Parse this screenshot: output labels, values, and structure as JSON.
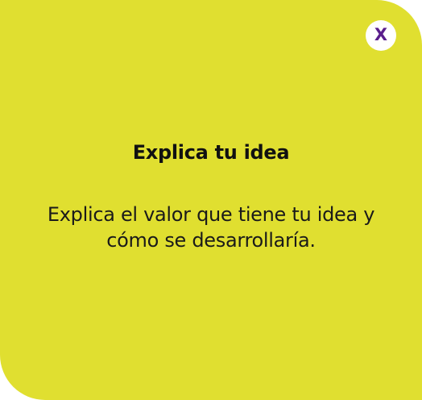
{
  "popup": {
    "close_label": "X",
    "title": "Explica tu idea",
    "body": "Explica el valor que tiene tu idea y cómo se desarrollaría."
  },
  "colors": {
    "card_background": "#e0df30",
    "close_button_background": "#ffffff",
    "close_glyph": "#5a1e8c",
    "text": "#111111"
  },
  "icons": {
    "close": "close-icon"
  }
}
